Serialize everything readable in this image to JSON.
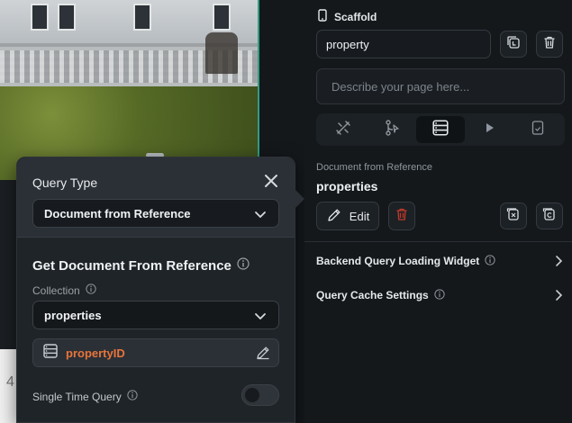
{
  "popup": {
    "query_type_label": "Query Type",
    "query_type_value": "Document from Reference",
    "section_title": "Get Document From Reference",
    "collection_label": "Collection",
    "collection_value": "properties",
    "reference_field": "propertyID",
    "single_time_query_label": "Single Time Query",
    "single_time_query_enabled": false
  },
  "panel": {
    "widget_title": "Scaffold",
    "page_name": "property",
    "description_placeholder": "Describe your page here...",
    "tabs": [
      {
        "icon": "tools-icon",
        "active": false
      },
      {
        "icon": "action-flow-icon",
        "active": false
      },
      {
        "icon": "backend-query-icon",
        "active": true
      },
      {
        "icon": "play-icon",
        "active": false
      },
      {
        "icon": "document-icon",
        "active": false
      }
    ],
    "query_type_label": "Document from Reference",
    "query_collection": "properties",
    "edit_label": "Edit",
    "rows": [
      {
        "label": "Backend Query Loading Widget"
      },
      {
        "label": "Query Cache Settings"
      }
    ]
  },
  "canvas": {
    "partial_digit": "4"
  },
  "colors": {
    "accent_orange": "#e8743b",
    "delete_red": "#c0392b",
    "panel_bg": "#14181b"
  }
}
